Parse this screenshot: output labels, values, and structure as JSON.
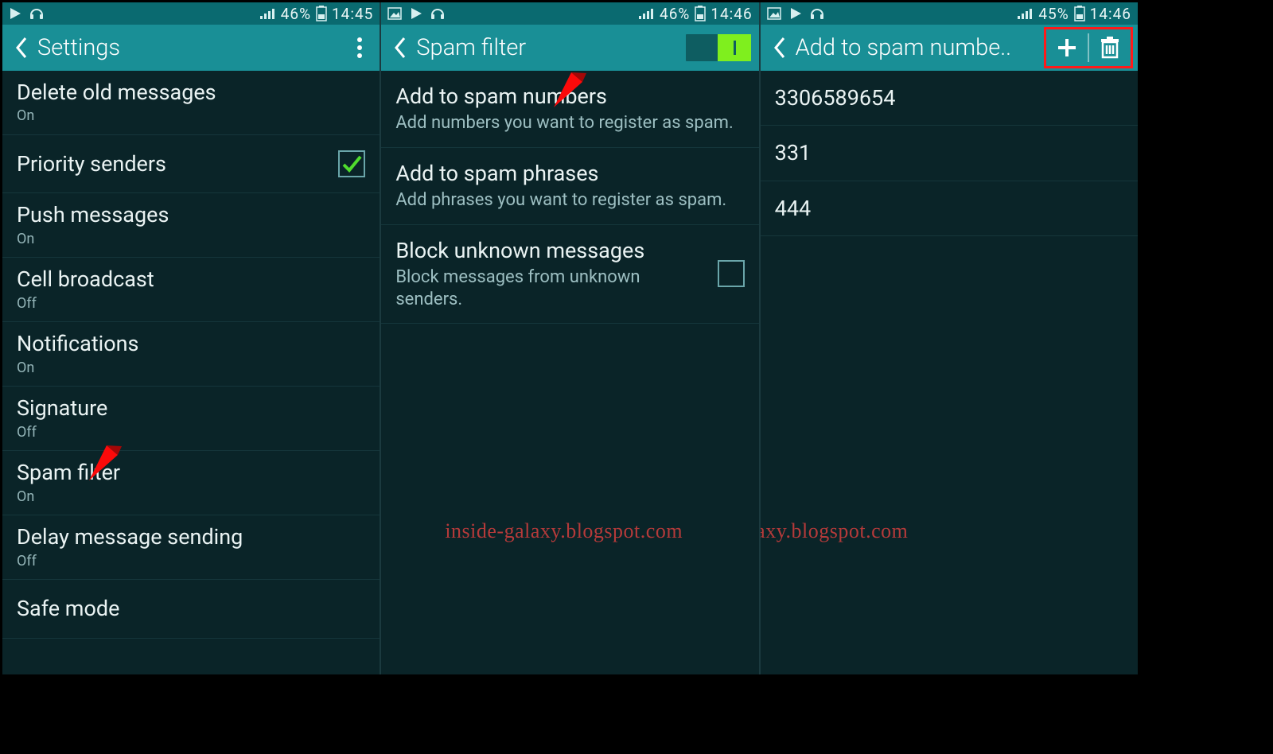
{
  "watermark": "inside-galaxy.blogspot.com",
  "panes": [
    {
      "status": {
        "battery": "46%",
        "time": "14:45"
      },
      "appbar": {
        "title": "Settings",
        "has_menu": true
      },
      "rows": [
        {
          "title": "Delete old messages",
          "sub": "On"
        },
        {
          "title": "Priority senders",
          "check": true
        },
        {
          "title": "Push messages",
          "sub": "On"
        },
        {
          "title": "Cell broadcast",
          "sub": "Off"
        },
        {
          "title": "Notifications",
          "sub": "On"
        },
        {
          "title": "Signature",
          "sub": "Off"
        },
        {
          "title": "Spam filter",
          "sub": "On"
        },
        {
          "title": "Delay message sending",
          "sub": "Off"
        },
        {
          "title": "Safe mode"
        }
      ]
    },
    {
      "status": {
        "battery": "46%",
        "time": "14:46"
      },
      "appbar": {
        "title": "Spam filter",
        "toggle_on": true
      },
      "rows": [
        {
          "title": "Add to spam numbers",
          "desc": "Add numbers you want to register as spam."
        },
        {
          "title": "Add to spam phrases",
          "desc": "Add phrases you want to register as spam."
        },
        {
          "title": "Block unknown messages",
          "desc": "Block messages from unknown senders.",
          "emptycheck": true
        }
      ]
    },
    {
      "status": {
        "battery": "45%",
        "time": "14:46"
      },
      "appbar": {
        "title": "Add to spam numbe..",
        "actions": true
      },
      "rows": [
        {
          "title": "3306589654"
        },
        {
          "title": "331"
        },
        {
          "title": "444"
        }
      ]
    }
  ]
}
